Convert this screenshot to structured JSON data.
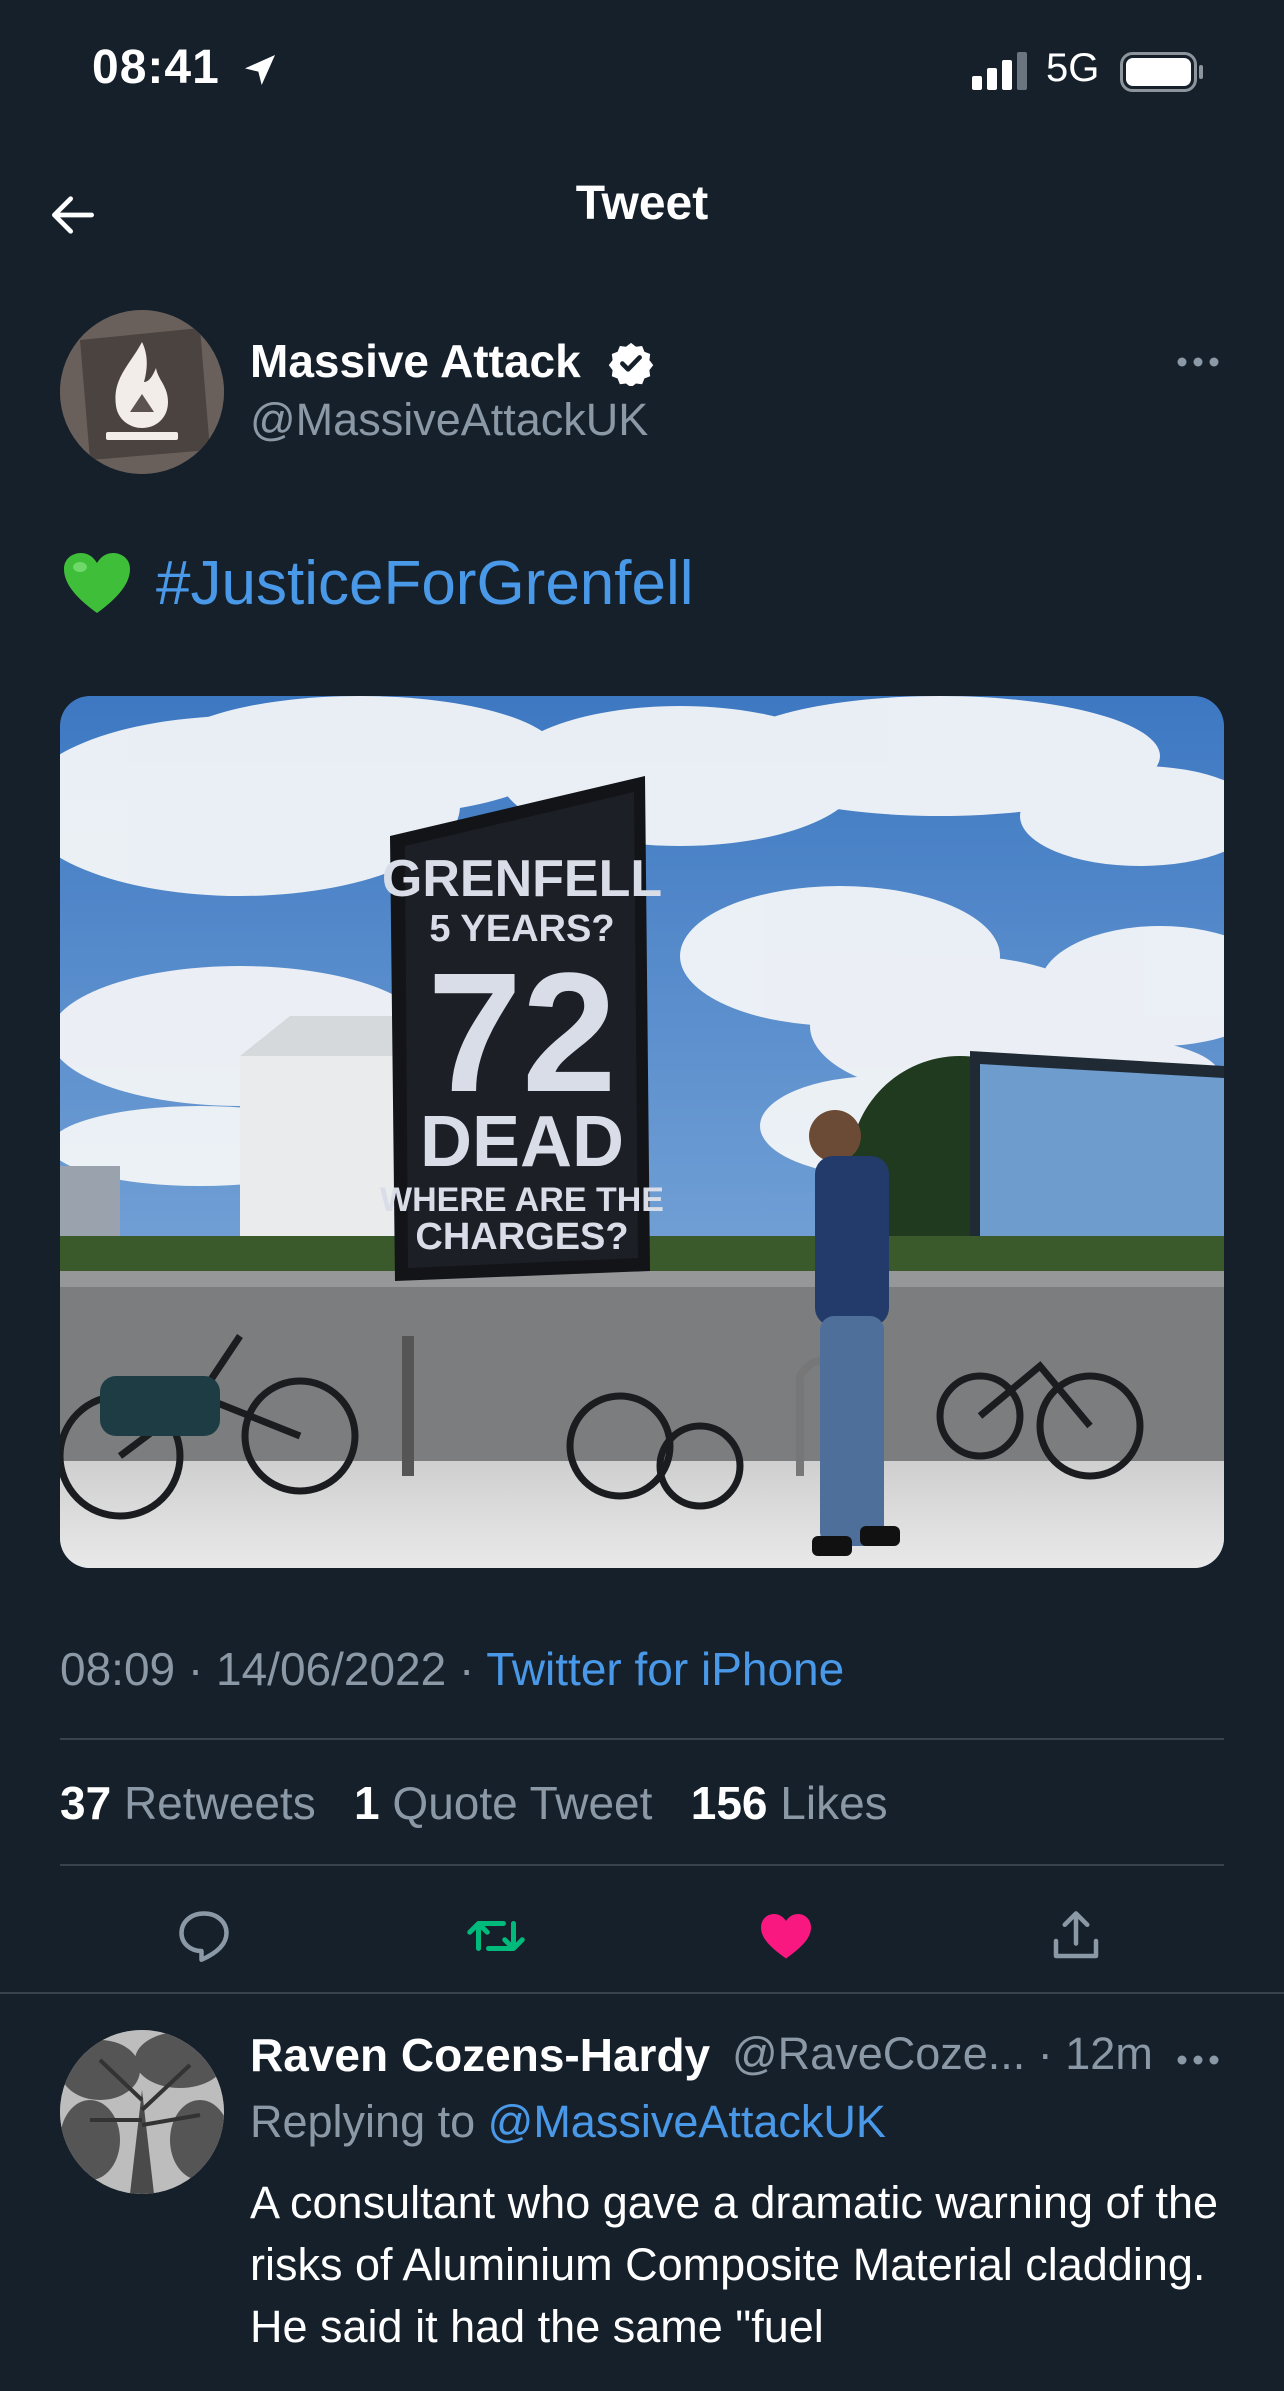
{
  "status_bar": {
    "time": "08:41",
    "network": "5G"
  },
  "header": {
    "title": "Tweet"
  },
  "tweet": {
    "author_name": "Massive Attack",
    "author_handle": "@MassiveAttackUK",
    "text_emoji": "green-heart-emoji",
    "hashtag": "#JusticeForGrenfell",
    "billboard": {
      "line1": "GRENFELL",
      "line2": "5 YEARS?",
      "line3": "72",
      "line4": "DEAD",
      "line5": "WHERE ARE THE",
      "line6": "CHARGES?"
    },
    "timestamp": "08:09 · 14/06/2022 · ",
    "source": "Twitter for iPhone",
    "retweets_count": "37",
    "retweets_label": "Retweets",
    "quotes_count": "1",
    "quotes_label": "Quote Tweet",
    "likes_count": "156",
    "likes_label": "Likes"
  },
  "reply": {
    "name": "Raven Cozens-Hardy",
    "handle_time": "@RaveCoze... · 12m",
    "replying_prefix": "Replying to ",
    "replying_to": "@MassiveAttackUK",
    "text": "A consultant who gave a dramatic warning of the risks of Aluminium Composite Material cladding. He said it had the same \"fuel"
  },
  "colors": {
    "background": "#15202b",
    "link": "#4a99e9",
    "muted": "#8b98a5",
    "retweet_active": "#00ba7c",
    "like_active": "#f91880"
  }
}
